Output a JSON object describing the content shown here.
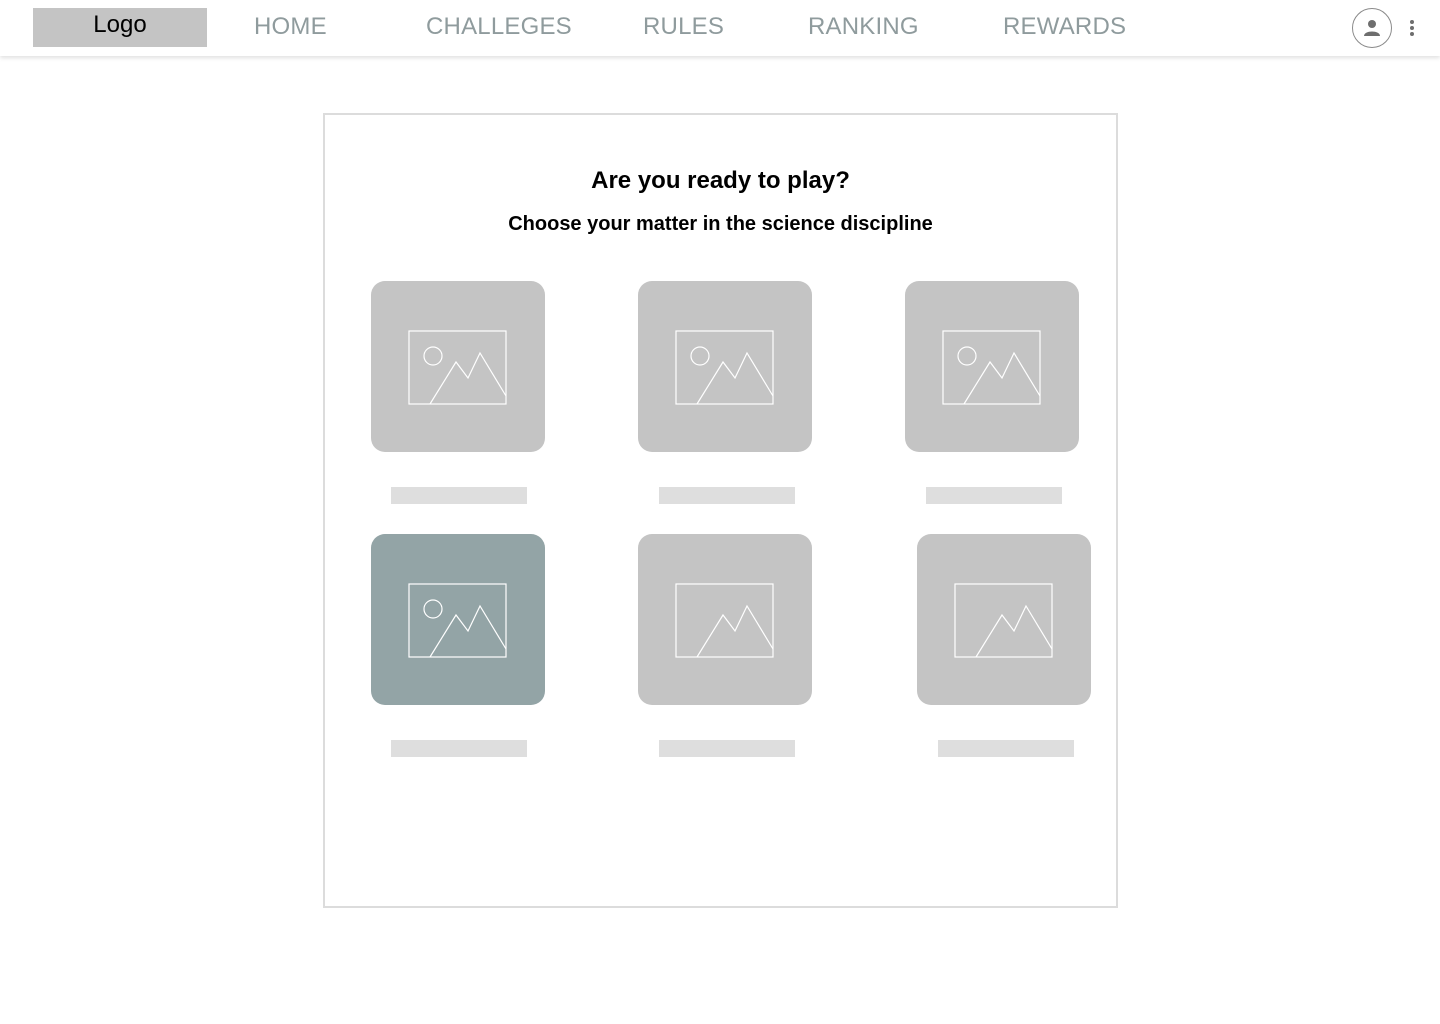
{
  "header": {
    "logo_label": "Logo",
    "nav": {
      "home": "HOME",
      "challenges": "CHALLEGES",
      "rules": "RULES",
      "ranking": "RANKING",
      "rewards": "REWARDS"
    },
    "icons": {
      "account": "user-circle-icon",
      "menu": "more-vertical-icon"
    }
  },
  "main": {
    "title": "Are you ready to play?",
    "subtitle": "Choose your matter in the science discipline",
    "disciplines": [
      {
        "icon": "image-placeholder-icon",
        "selected": false
      },
      {
        "icon": "image-placeholder-icon",
        "selected": false
      },
      {
        "icon": "image-placeholder-icon",
        "selected": false
      },
      {
        "icon": "image-placeholder-icon",
        "selected": true
      },
      {
        "icon": "image-placeholder-icon",
        "selected": false
      },
      {
        "icon": "image-placeholder-icon",
        "selected": false
      }
    ]
  },
  "colors": {
    "logo_bg": "#C4C4C4",
    "nav_text": "#8F9B9D",
    "card_bg": "#C4C4C4",
    "card_selected_bg": "#93A4A6",
    "label_placeholder": "#DEDEDE",
    "panel_border": "#DCDCDC"
  }
}
